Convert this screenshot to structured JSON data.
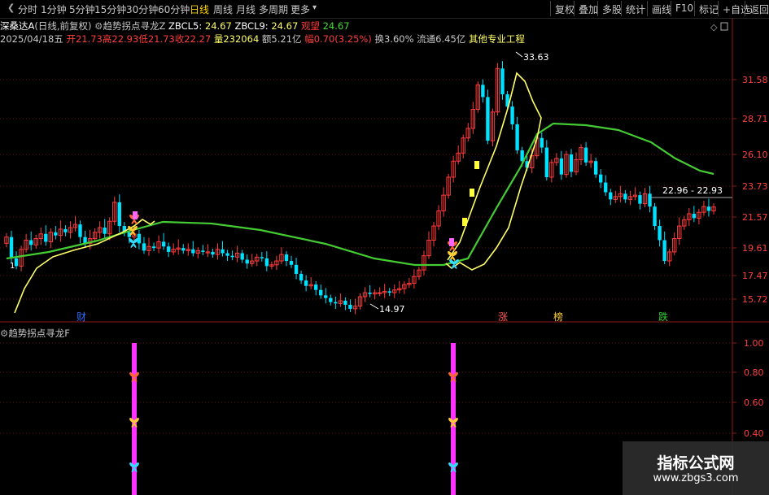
{
  "period_tabs": [
    "分时",
    "1分钟",
    "5分钟",
    "15分钟",
    "30分钟",
    "60分钟",
    "日线",
    "周线",
    "月线",
    "多周期",
    "更多"
  ],
  "active_tab": "日线",
  "right_buttons": [
    "复权",
    "叠加",
    "多股",
    "统计",
    "画线",
    "F10",
    "标记",
    "+自选",
    "返回"
  ],
  "stock": {
    "name": "深桑达A",
    "mode": "(日线,前复权)",
    "indicator": "趋势拐点寻龙Z",
    "zbcl5_label": "ZBCL5:",
    "zbcl5_value": "24.67",
    "zbcl9_label": "ZBCL9:",
    "zbcl9_value": "24.67",
    "signal_label": "观望",
    "signal_value": "24.67"
  },
  "quote": {
    "date": "2025/04/18五",
    "open_label": "开",
    "open": "21.73",
    "high_label": "高",
    "high": "22.93",
    "low_label": "低",
    "low": "21.73",
    "close_label": "收",
    "close": "22.27",
    "volume_label": "量",
    "volume": "232064",
    "amount_label": "额",
    "amount": "5.21亿",
    "change_label": "幅",
    "change": "0.70(3.25%)",
    "turnover_label": "换",
    "turnover": "3.60%",
    "float_label": "流通",
    "float": "6.45亿",
    "sector": "其他专业工程"
  },
  "price_axis": [
    "31.58",
    "28.71",
    "26.10",
    "23.73",
    "21.57",
    "19.61",
    "17.47",
    "15.72"
  ],
  "price_annotations": {
    "high": "33.63",
    "low": "14.97",
    "range": "22.96 - 22.93"
  },
  "event_markers": [
    "财",
    "涨",
    "榜",
    "跌"
  ],
  "sub_indicator": {
    "title": "趋势拐点寻龙F"
  },
  "sub_axis": [
    "1.00",
    "0.80",
    "0.60",
    "0.40"
  ],
  "watermark": {
    "line1": "指标公式网",
    "line2": "www.zbgs3.com"
  },
  "colors": {
    "up": "#ff3c3c",
    "down": "#00e0ff",
    "green_line": "#44cc33",
    "yellow_line": "#ffff66",
    "magenta": "#ff33ff",
    "active_tab": "#ffd700"
  }
}
